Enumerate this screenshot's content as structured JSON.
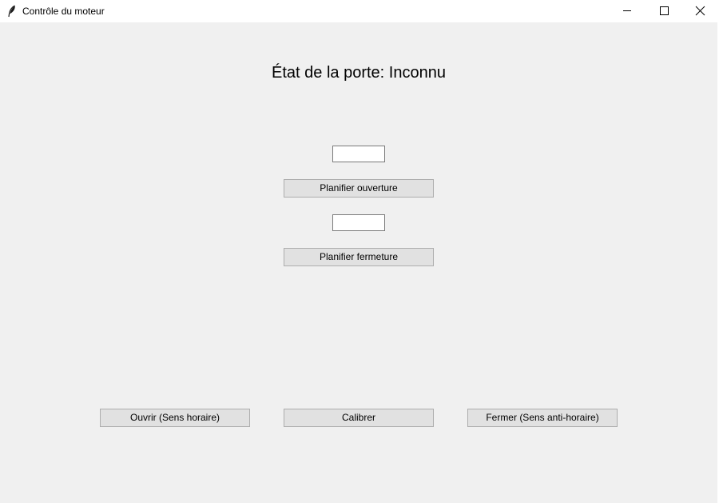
{
  "window": {
    "title": "Contrôle du moteur",
    "icon": "feather-icon",
    "controls": [
      "minimize-icon",
      "maximize-icon",
      "close-icon"
    ]
  },
  "status": {
    "text": "État de la porte: Inconnu"
  },
  "schedule": {
    "open_time_value": "",
    "open_button_label": "Planifier ouverture",
    "close_time_value": "",
    "close_button_label": "Planifier fermeture"
  },
  "motor": {
    "open_button_label": "Ouvrir (Sens horaire)",
    "calibrate_button_label": "Calibrer",
    "close_button_label": "Fermer (Sens anti-horaire)"
  }
}
